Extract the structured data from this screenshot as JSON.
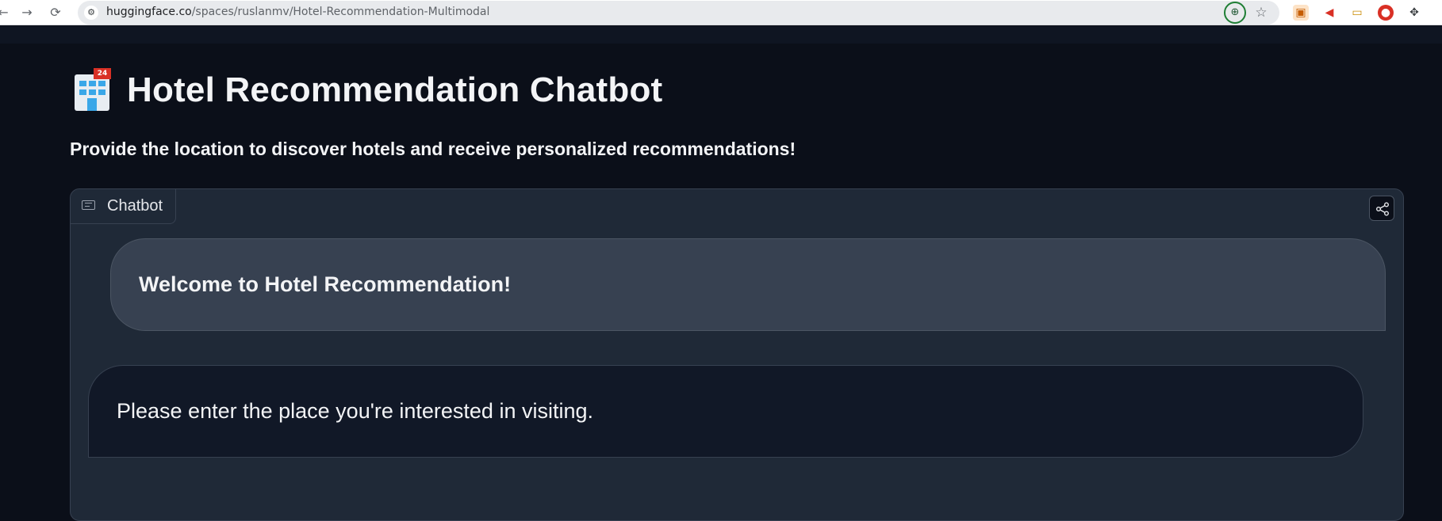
{
  "browser": {
    "url_host": "huggingface.co",
    "url_path": "/spaces/ruslanmv/Hotel-Recommendation-Multimodal"
  },
  "page": {
    "title": "Hotel Recommendation Chatbot",
    "subtitle": "Provide the location to discover hotels and receive personalized recommendations!",
    "hotel_sign": "24"
  },
  "chatbot": {
    "label": "Chatbot",
    "messages": [
      {
        "role": "user",
        "text": "Welcome to Hotel Recommendation!"
      },
      {
        "role": "bot",
        "text": "Please enter the place you're interested in visiting."
      }
    ]
  },
  "colors": {
    "background": "#0b0f19",
    "panel": "#1f2937",
    "user_bubble": "#374151",
    "bot_bubble": "#111827"
  }
}
